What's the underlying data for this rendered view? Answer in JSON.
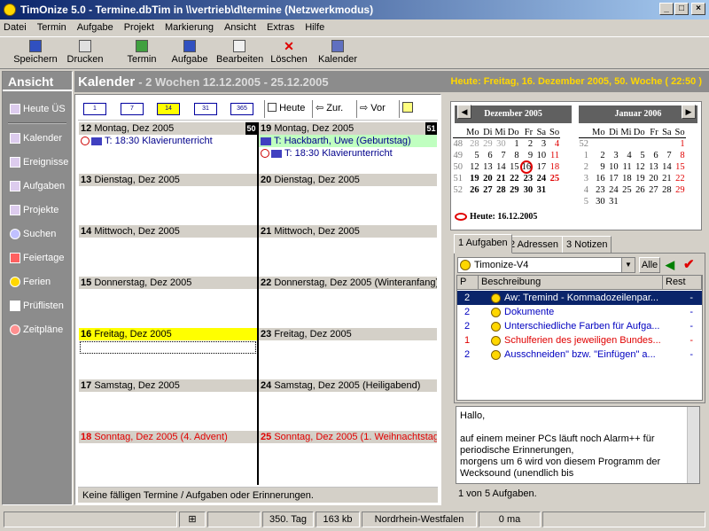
{
  "window": {
    "title": "TimOnize 5.0 - Termine.dbTim in \\\\vertrieb\\d\\termine (Netzwerkmodus)"
  },
  "menu": [
    {
      "label": "Datei"
    },
    {
      "label": "Termin"
    },
    {
      "label": "Aufgabe"
    },
    {
      "label": "Projekt"
    },
    {
      "label": "Markierung"
    },
    {
      "label": "Ansicht"
    },
    {
      "label": "Extras"
    },
    {
      "label": "Hilfe"
    }
  ],
  "toolbar": {
    "save": "Speichern",
    "print": "Drucken",
    "appt": "Termin",
    "task": "Aufgabe",
    "edit": "Bearbeiten",
    "delete": "Löschen",
    "calendar": "Kalender"
  },
  "sidebar": {
    "title": "Ansicht",
    "items": [
      {
        "label": "Heute ÜS"
      },
      {
        "label": "Kalender"
      },
      {
        "label": "Ereignisse"
      },
      {
        "label": "Aufgaben"
      },
      {
        "label": "Projekte"
      },
      {
        "label": "Suchen"
      },
      {
        "label": "Feiertage"
      },
      {
        "label": "Ferien"
      },
      {
        "label": "Prüflisten"
      },
      {
        "label": "Zeitpläne"
      }
    ]
  },
  "calendar": {
    "title": "Kalender",
    "subtitle": "- 2 Wochen  12.12.2005 - 25.12.2005",
    "views": [
      "1",
      "7",
      "14",
      "31",
      "365"
    ],
    "nav": {
      "today": "Heute",
      "back": "Zur.",
      "forward": "Vor"
    },
    "status": "Keine fälligen Termine / Aufgaben oder Erinnerungen.",
    "week1": {
      "num": "50",
      "days": [
        {
          "num": "12",
          "label": "Montag, Dez 2005",
          "events": [
            "T: 18:30 Klavierunterricht"
          ]
        },
        {
          "num": "13",
          "label": "Dienstag, Dez 2005"
        },
        {
          "num": "14",
          "label": "Mittwoch, Dez 2005"
        },
        {
          "num": "15",
          "label": "Donnerstag, Dez 2005"
        },
        {
          "num": "16",
          "label": "Freitag, Dez 2005"
        },
        {
          "num": "17",
          "label": "Samstag, Dez 2005"
        },
        {
          "num": "18",
          "label": "Sonntag, Dez 2005 (4. Advent)"
        }
      ]
    },
    "week2": {
      "num": "51",
      "days": [
        {
          "num": "19",
          "label": "Montag, Dez 2005",
          "events": [
            "T: Hackbarth, Uwe (Geburtstag)",
            "T: 18:30 Klavierunterricht"
          ]
        },
        {
          "num": "20",
          "label": "Dienstag, Dez 2005"
        },
        {
          "num": "21",
          "label": "Mittwoch, Dez 2005"
        },
        {
          "num": "22",
          "label": "Donnerstag, Dez 2005 (Winteranfang)"
        },
        {
          "num": "23",
          "label": "Freitag, Dez 2005"
        },
        {
          "num": "24",
          "label": "Samstag, Dez 2005 (Heiligabend)"
        },
        {
          "num": "25",
          "label": "Sonntag, Dez 2005 (1. Weihnachtstag)"
        }
      ]
    }
  },
  "today_header": "Heute: Freitag, 16. Dezember 2005, 50. Woche ( 22:50 )",
  "minical": {
    "dec": "Dezember 2005",
    "jan": "Januar 2006",
    "weekdays": [
      "Mo",
      "Di",
      "Mi",
      "Do",
      "Fr",
      "Sa",
      "So"
    ],
    "today": "Heute: 16.12.2005",
    "dec_weeks": [
      [
        "48",
        "28",
        "29",
        "30",
        "1",
        "2",
        "3",
        "4"
      ],
      [
        "49",
        "5",
        "6",
        "7",
        "8",
        "9",
        "10",
        "11"
      ],
      [
        "50",
        "12",
        "13",
        "14",
        "15",
        "16",
        "17",
        "18"
      ],
      [
        "51",
        "19",
        "20",
        "21",
        "22",
        "23",
        "24",
        "25"
      ],
      [
        "52",
        "26",
        "27",
        "28",
        "29",
        "30",
        "31",
        ""
      ]
    ],
    "jan_weeks": [
      [
        "52",
        "",
        "",
        "",
        "",
        "",
        "",
        "1"
      ],
      [
        "1",
        "2",
        "3",
        "4",
        "5",
        "6",
        "7",
        "8"
      ],
      [
        "2",
        "9",
        "10",
        "11",
        "12",
        "13",
        "14",
        "15"
      ],
      [
        "3",
        "16",
        "17",
        "18",
        "19",
        "20",
        "21",
        "22"
      ],
      [
        "4",
        "23",
        "24",
        "25",
        "26",
        "27",
        "28",
        "29"
      ],
      [
        "5",
        "30",
        "31",
        "",
        "",
        "",
        "",
        ""
      ]
    ]
  },
  "tabs": [
    {
      "label": "1 Aufgaben"
    },
    {
      "label": "2 Adressen"
    },
    {
      "label": "3 Notizen"
    }
  ],
  "tasks": {
    "project": "Timonize-V4",
    "all": "Alle",
    "cols": {
      "p": "P",
      "desc": "Beschreibung",
      "rest": "Rest"
    },
    "rows": [
      {
        "p": "2",
        "desc": "Aw: Tremind - Kommadozeilenpar...",
        "rest": "-"
      },
      {
        "p": "2",
        "desc": "Dokumente",
        "rest": "-"
      },
      {
        "p": "2",
        "desc": "Unterschiedliche Farben für Aufga...",
        "rest": "-"
      },
      {
        "p": "1",
        "desc": "Schulferien des jeweiligen Bundes...",
        "rest": "-"
      },
      {
        "p": "2",
        "desc": "Ausschneiden\" bzw. \"Einfügen\" a...",
        "rest": "-"
      }
    ],
    "count": "1 von 5 Aufgaben."
  },
  "notes": {
    "l1": "Hallo,",
    "l2": "auf einem meiner PCs läuft noch Alarm++ für",
    "l3": "periodische Erinnerungen,",
    "l4": "morgens um 6 wird von diesem Programm der",
    "l5": "Wecksound (unendlich bis"
  },
  "status": {
    "day": "350. Tag",
    "size": "163 kb",
    "region": "Nordrhein-Westfalen",
    "ma": "0 ma"
  }
}
